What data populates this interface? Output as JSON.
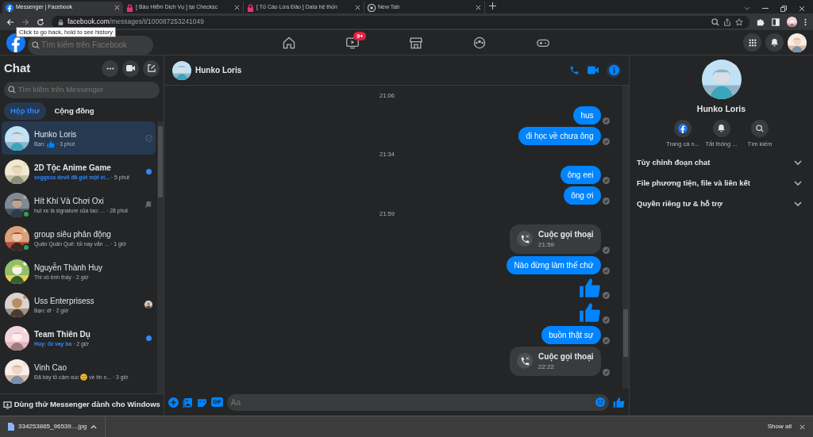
{
  "browser": {
    "tabs": [
      {
        "title": "Messenger | Facebook",
        "kind": "facebook",
        "selected": true
      },
      {
        "title": "[ Bảo Hiểm Dịch Vụ ] tại Checksc",
        "kind": "lock",
        "selected": false
      },
      {
        "title": "[ Tố Cáo Lừa Đảo ] Data hệ thốn",
        "kind": "lock",
        "selected": false
      },
      {
        "title": "New Tab",
        "kind": "chrome",
        "selected": false
      }
    ],
    "url": {
      "domain": "facebook.com",
      "path": "/messages/t/100087253241049"
    },
    "tooltip": "Click to go back, hold to see history"
  },
  "facebook_nav": {
    "search": {
      "placeholder": "Tìm kiếm trên Facebook"
    },
    "watch_badge": "9+"
  },
  "sidebar": {
    "title": "Chat",
    "search": {
      "placeholder": "Tìm kiếm trên Messenger"
    },
    "filters": [
      {
        "label": "Hộp thư",
        "selected": true
      },
      {
        "label": "Cộng đồng",
        "selected": false
      }
    ],
    "conversations": [
      {
        "name": "Hunko Loris",
        "preview": [
          {
            "kind": "text",
            "text": "Bạn:"
          },
          {
            "kind": "like"
          }
        ],
        "time": "· 3 phút",
        "unread": false,
        "online": false,
        "seen": true,
        "muted": false,
        "seen_by_avatar": false,
        "selected": true
      },
      {
        "name": "2D Tộc Anime Game",
        "preview": [
          {
            "kind": "text",
            "text": "seggsss devil đã gửi một vi..."
          }
        ],
        "time": "· 5 phút",
        "unread": true,
        "online": false,
        "seen": false,
        "muted": false,
        "seen_by_avatar": false,
        "selected": false
      },
      {
        "name": "Hít Khí Và Chơi Oxi",
        "preview": [
          {
            "kind": "text",
            "text": "hụt xe là signature của tao: ..."
          }
        ],
        "time": "· 28 phút",
        "unread": false,
        "online": true,
        "seen": false,
        "muted": true,
        "seen_by_avatar": false,
        "selected": false
      },
      {
        "name": "group siêu phản động",
        "preview": [
          {
            "kind": "text",
            "text": "Quân Quân Quê: tối nay vẫn ..."
          }
        ],
        "time": "· 1 giờ",
        "unread": false,
        "online": true,
        "seen": false,
        "muted": false,
        "seen_by_avatar": false,
        "selected": false
      },
      {
        "name": "Nguyễn Thành Huy",
        "preview": [
          {
            "kind": "text",
            "text": "Thì vô tình thấy"
          }
        ],
        "time": "· 2 giờ",
        "unread": false,
        "online": false,
        "seen": false,
        "muted": false,
        "seen_by_avatar": false,
        "selected": false
      },
      {
        "name": "Uss Enterprisess",
        "preview": [
          {
            "kind": "text",
            "text": "Bạn: df"
          }
        ],
        "time": "· 2 giờ",
        "unread": false,
        "online": false,
        "seen": false,
        "muted": false,
        "seen_by_avatar": true,
        "selected": false
      },
      {
        "name": "Team Thiên Dụ",
        "preview": [
          {
            "kind": "text",
            "text": "Huy: Gì vay ba"
          }
        ],
        "time": "· 2 giờ",
        "unread": true,
        "online": false,
        "seen": false,
        "muted": false,
        "seen_by_avatar": false,
        "selected": false
      },
      {
        "name": "Vinh Cao",
        "preview": [
          {
            "kind": "text",
            "text": "Đã bày tỏ cảm xúc"
          },
          {
            "kind": "emoji"
          },
          {
            "kind": "text",
            "text": "về tin n..."
          }
        ],
        "time": "· 3 giờ",
        "unread": false,
        "online": false,
        "seen": false,
        "muted": false,
        "seen_by_avatar": false,
        "selected": false
      }
    ],
    "footer": "Dùng thử Messenger dành cho Windows"
  },
  "chat": {
    "name": "Hunko Loris",
    "messages": [
      {
        "kind": "time",
        "text": "21:06"
      },
      {
        "kind": "text",
        "text": "hus"
      },
      {
        "kind": "text",
        "text": "đi học về chưa ông"
      },
      {
        "kind": "time",
        "text": "21:34"
      },
      {
        "kind": "text",
        "text": "ông eei"
      },
      {
        "kind": "text",
        "text": "ông ơi"
      },
      {
        "kind": "time",
        "text": "21:59"
      },
      {
        "kind": "call",
        "text": "Cuộc gọi thoại",
        "time": "21:59"
      },
      {
        "kind": "text",
        "text": "Nào đừng làm thế chứ"
      },
      {
        "kind": "like"
      },
      {
        "kind": "like"
      },
      {
        "kind": "text",
        "text": "buồn thật sự"
      },
      {
        "kind": "call",
        "text": "Cuộc gọi thoại",
        "time": "22:22"
      }
    ],
    "gif_label": "GIF",
    "composer": {
      "placeholder": "Aa"
    }
  },
  "info": {
    "name": "Hunko Loris",
    "actions": [
      {
        "kind": "facebook",
        "label": "Trang cá n..."
      },
      {
        "kind": "bell",
        "label": "Tắt thông ..."
      },
      {
        "kind": "search",
        "label": "Tìm kiếm"
      }
    ],
    "sections": [
      "Tùy chỉnh đoạn chat",
      "File phương tiện, file và liên kết",
      "Quyền riêng tư & hỗ trợ"
    ]
  },
  "downloads": {
    "file": "334253865_96539....jpg",
    "show_all": "Show all"
  }
}
